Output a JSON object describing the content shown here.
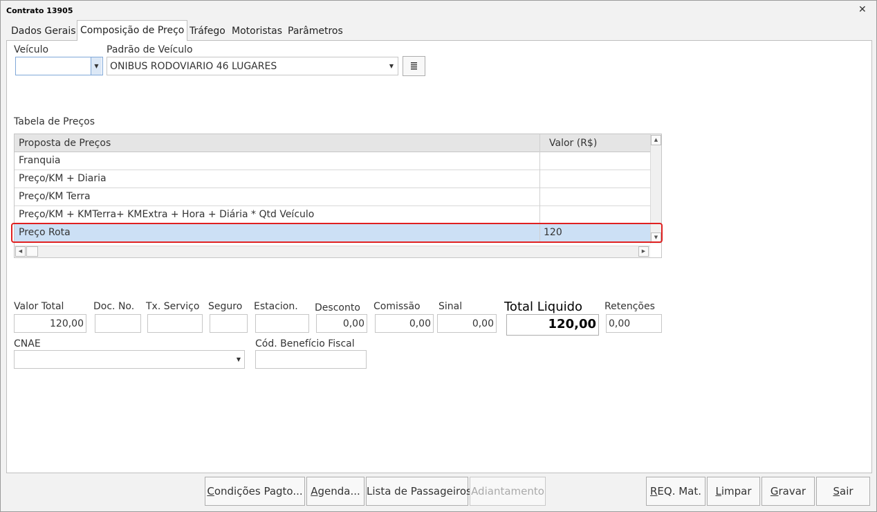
{
  "window": {
    "title": "Contrato 13905"
  },
  "tabs": [
    {
      "label": "Dados Gerais"
    },
    {
      "label": "Composição de Preço"
    },
    {
      "label": "Tráfego"
    },
    {
      "label": "Motoristas"
    },
    {
      "label": "Parâmetros"
    }
  ],
  "vehicle": {
    "veiculo_label": "Veículo",
    "veiculo_value": "",
    "padrao_label": "Padrão de Veículo",
    "padrao_value": "ONIBUS RODOVIARIO 46 LUGARES"
  },
  "price_table": {
    "title": "Tabela de Preços",
    "columns": [
      "Proposta de Preços",
      "Valor (R$)"
    ],
    "rows": [
      {
        "proposta": "Franquia",
        "valor": ""
      },
      {
        "proposta": "Preço/KM + Diaria",
        "valor": ""
      },
      {
        "proposta": "Preço/KM  Terra",
        "valor": ""
      },
      {
        "proposta": "Preço/KM + KMTerra+ KMExtra + Hora + Diária * Qtd Veículo",
        "valor": ""
      },
      {
        "proposta": "Preço Rota",
        "valor": "120"
      }
    ],
    "selected_row": 4
  },
  "totals": {
    "valor_total_label": "Valor Total",
    "valor_total": "120,00",
    "doc_no_label": "Doc. No.",
    "doc_no": "",
    "tx_servico_label": "Tx. Serviço",
    "tx_servico": "",
    "seguro_label": "Seguro",
    "seguro": "",
    "estacion_label": "Estacion.",
    "estacion": "",
    "desconto_label": "Desconto",
    "desconto": "0,00",
    "comissao_label": "Comissão",
    "comissao": "0,00",
    "sinal_label": "Sinal",
    "sinal": "0,00",
    "total_liquido_label": "Total Liquido",
    "total_liquido": "120,00",
    "retencoes_label": "Retenções",
    "retencoes": "0,00"
  },
  "fiscal": {
    "cnae_label": "CNAE",
    "cnae_value": "",
    "beneficio_label": "Cód. Benefício Fiscal",
    "beneficio_value": ""
  },
  "buttons": {
    "condicoes": {
      "u": "C",
      "rest": "ondições Pagto..."
    },
    "agenda": {
      "u": "A",
      "rest": "genda..."
    },
    "lista": {
      "label": "Lista de Passageiros..."
    },
    "adiantamento": {
      "label": "Adiantamento"
    },
    "req": {
      "u": "R",
      "rest": "EQ. Mat."
    },
    "limpar": {
      "u": "L",
      "rest": "impar"
    },
    "gravar": {
      "u": "G",
      "rest": "ravar"
    },
    "sair": {
      "u": "S",
      "rest": "air"
    }
  },
  "colors": {
    "selection": "#cce0f5",
    "highlight": "#e02020",
    "header": "#e5e5e5"
  },
  "icons": [
    "close-icon",
    "dropdown-arrow-icon",
    "list-icon",
    "scroll-up-icon",
    "scroll-down-icon",
    "scroll-left-icon",
    "scroll-right-icon"
  ]
}
